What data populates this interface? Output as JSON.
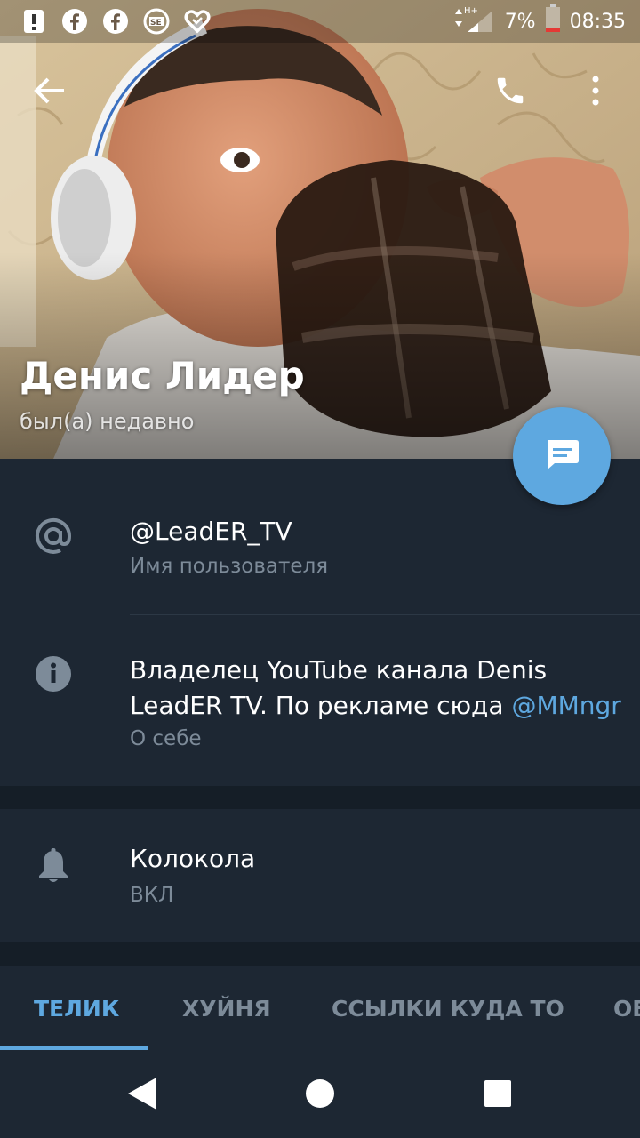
{
  "status_bar": {
    "left_icons": [
      "alert-icon",
      "facebook-icon",
      "facebook-icon",
      "se-icon",
      "heart-icon"
    ],
    "network": "H+",
    "battery": "7%",
    "time": "08:35"
  },
  "toolbar": {
    "back_icon": "arrow-left-icon",
    "call_icon": "phone-icon",
    "menu_icon": "more-vert-icon"
  },
  "profile": {
    "name": "Денис Лидер",
    "status": "был(а) недавно"
  },
  "info": {
    "username": "@LeadER_TV",
    "username_label": "Имя пользователя",
    "bio_line1": "Владелец YouTube канала Denis",
    "bio_line2": "LeadER TV. По рекламе сюда ",
    "bio_link": "@MMngr",
    "bio_label": "О себе"
  },
  "notifications": {
    "title": "Колокола",
    "value": "ВКЛ"
  },
  "tabs": [
    {
      "label": "ТЕЛИК"
    },
    {
      "label": "ХУЙНЯ"
    },
    {
      "label": "ССЫЛКИ КУДА ТО"
    },
    {
      "label": "ОБ"
    }
  ],
  "colors": {
    "accent": "#5ea8e0",
    "background": "#1d2733",
    "secondary_text": "#7d8b99"
  }
}
